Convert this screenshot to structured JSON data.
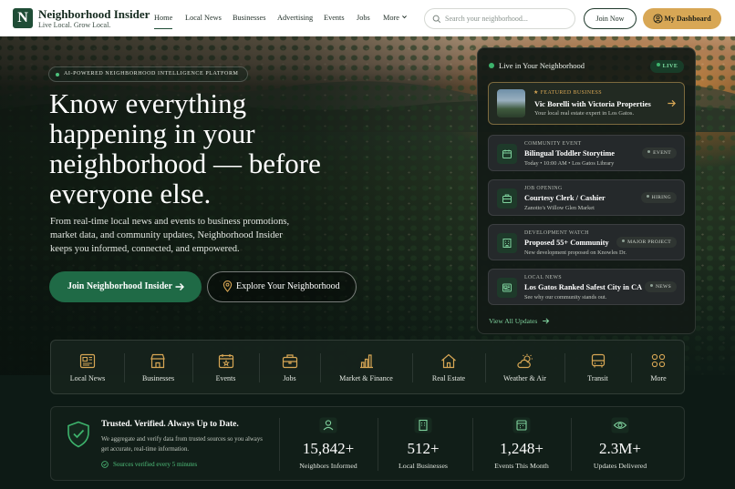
{
  "nav": {
    "logo_letter": "N",
    "brand_name": "Neighborhood Insider",
    "tagline": "Live Local. Grow Local.",
    "items": [
      "Home",
      "Local News",
      "Businesses",
      "Advertising",
      "Events",
      "Jobs",
      "More"
    ],
    "search_placeholder": "Search your neighborhood...",
    "join_label": "Join Now",
    "dashboard_label": "My Dashboard"
  },
  "hero": {
    "badge": "AI-POWERED NEIGHBORHOOD INTELLIGENCE PLATFORM",
    "headline": "Know everything happening in your neighborhood — before everyone else.",
    "subtext": "From real-time local news and events to business promotions, market data, and community updates, Neighborhood Insider keeps you informed, connected, and empowered.",
    "cta_primary": "Join Neighborhood Insider",
    "cta_secondary": "Explore Your Neighborhood"
  },
  "live_panel": {
    "title": "Live in Your Neighborhood",
    "live_badge": "LIVE",
    "featured": {
      "label": "FEATURED BUSINESS",
      "title": "Vic Borelli with Victoria Properties",
      "description": "Your local real estate expert in Los Gatos."
    },
    "cards": [
      {
        "label": "COMMUNITY EVENT",
        "title": "Bilingual Toddler Storytime",
        "description": "Today • 10:00 AM • Los Gatos Library",
        "badge": "EVENT",
        "icon": "calendar-icon"
      },
      {
        "label": "JOB OPENING",
        "title": "Courtesy Clerk / Cashier",
        "description": "Zanotto's Willow Glen Market",
        "badge": "HIRING",
        "icon": "briefcase-icon"
      },
      {
        "label": "DEVELOPMENT WATCH",
        "title": "Proposed 55+ Community",
        "description": "New development proposed on Knowles Dr.",
        "badge": "MAJOR PROJECT",
        "icon": "building-icon"
      },
      {
        "label": "LOCAL NEWS",
        "title": "Los Gatos Ranked Safest City in CA",
        "description": "See why our community stands out.",
        "badge": "NEWS",
        "icon": "newspaper-icon"
      }
    ],
    "view_all": "View All Updates"
  },
  "categories": [
    "Local News",
    "Businesses",
    "Events",
    "Jobs",
    "Market & Finance",
    "Real Estate",
    "Weather & Air",
    "Transit",
    "More"
  ],
  "trust": {
    "heading": "Trusted. Verified. Always Up to Date.",
    "description": "We aggregate and verify data from trusted sources so you always get accurate, real-time information.",
    "verified": "Sources verified every 5 minutes"
  },
  "stats": [
    {
      "value": "15,842+",
      "label": "Neighbors Informed"
    },
    {
      "value": "512+",
      "label": "Local Businesses"
    },
    {
      "value": "1,248+",
      "label": "Events This Month"
    },
    {
      "value": "2.3M+",
      "label": "Updates Delivered"
    }
  ],
  "colors": {
    "brand_green": "#1f4d36",
    "accent_gold": "#d8a755",
    "live_green": "#3db36c"
  }
}
